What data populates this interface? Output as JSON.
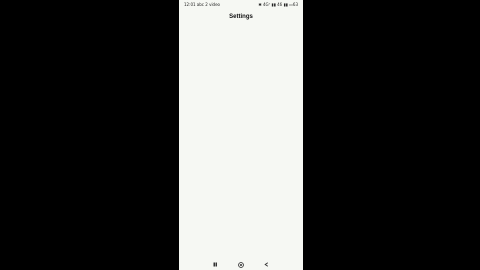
{
  "status_bar": {
    "left_text": "12:01 abc 2 video",
    "right_text": "✱ 4Gᵀ ▮▮ 46 ▮▮ ▭63"
  },
  "header": {
    "title": "Settings"
  },
  "nav_bar": {
    "recent_icon": "recent-apps-icon",
    "home_icon": "home-icon",
    "back_icon": "back-icon"
  },
  "colors": {
    "screen_background": "#f6f8f3",
    "outer_background": "#000000"
  }
}
